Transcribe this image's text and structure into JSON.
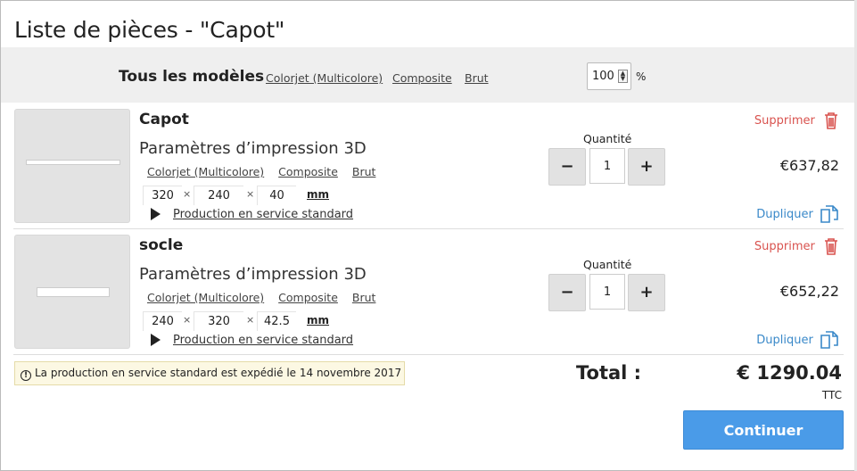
{
  "dialog": {
    "title": "Liste de pièces - \"Capot\""
  },
  "all_models": {
    "label": "Tous les modèles",
    "materials": [
      "Colorjet (Multicolore)",
      "Composite",
      "Brut"
    ],
    "scale_value": "100",
    "scale_unit": "%"
  },
  "items": [
    {
      "name": "Capot",
      "subtitle": "Paramètres d’impression 3D",
      "materials": [
        "Colorjet (Multicolore)",
        "Composite",
        "Brut"
      ],
      "dims": [
        "320",
        "240",
        "40"
      ],
      "dim_sep": "×",
      "unit": "mm",
      "production": "Production en service standard",
      "quantity_label": "Quantité",
      "quantity": "1",
      "minus": "−",
      "plus": "+",
      "price": "€637,82",
      "delete_label": "Supprimer",
      "duplicate_label": "Dupliquer"
    },
    {
      "name": "socle",
      "subtitle": "Paramètres d’impression 3D",
      "materials": [
        "Colorjet (Multicolore)",
        "Composite",
        "Brut"
      ],
      "dims": [
        "240",
        "320",
        "42.5"
      ],
      "dim_sep": "×",
      "unit": "mm",
      "production": "Production en service standard",
      "quantity_label": "Quantité",
      "quantity": "1",
      "minus": "−",
      "plus": "+",
      "price": "€652,22",
      "delete_label": "Supprimer",
      "duplicate_label": "Dupliquer"
    }
  ],
  "notice": {
    "icon": "info-icon",
    "text": "La production en service standard est expédié le 14 novembre 2017"
  },
  "total": {
    "label": "Total :",
    "value": "€ 1290.04",
    "tax_note": "TTC"
  },
  "actions": {
    "continue_label": "Continuer"
  },
  "colors": {
    "delete": "#d9534f",
    "duplicate": "#3a89c9",
    "primary_button": "#4a9be8",
    "notice_bg": "#fcf8e3"
  }
}
